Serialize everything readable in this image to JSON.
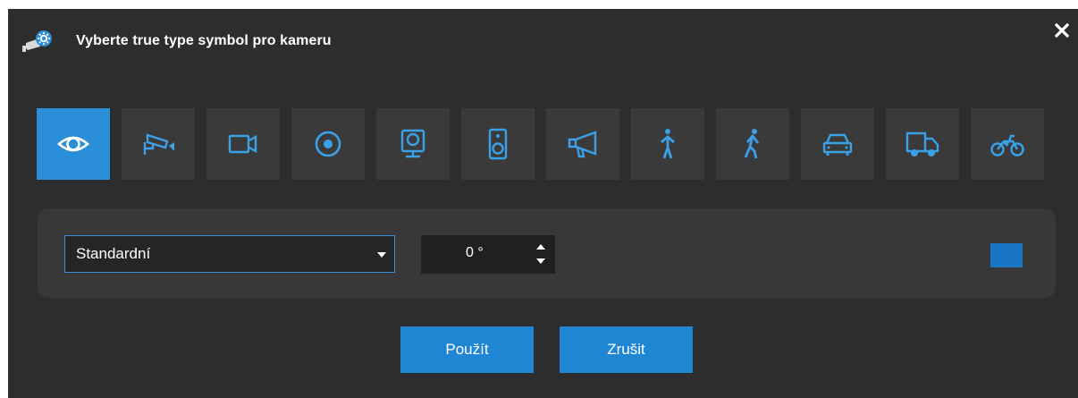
{
  "dialog": {
    "title": "Vyberte true type symbol pro kameru",
    "title_icon": "camera-settings-icon",
    "close_icon": "close-icon"
  },
  "symbols": [
    {
      "icon": "eye-icon",
      "selected": true
    },
    {
      "icon": "security-camera-icon",
      "selected": false
    },
    {
      "icon": "video-camera-icon",
      "selected": false
    },
    {
      "icon": "record-icon",
      "selected": false
    },
    {
      "icon": "webcam-icon",
      "selected": false
    },
    {
      "icon": "speaker-icon",
      "selected": false
    },
    {
      "icon": "megaphone-icon",
      "selected": false
    },
    {
      "icon": "person-standing-icon",
      "selected": false
    },
    {
      "icon": "person-walking-icon",
      "selected": false
    },
    {
      "icon": "car-icon",
      "selected": false
    },
    {
      "icon": "truck-icon",
      "selected": false
    },
    {
      "icon": "motorcycle-icon",
      "selected": false
    }
  ],
  "options": {
    "style_select": {
      "value": "Standardní"
    },
    "angle": {
      "value": "0 °"
    },
    "color": "#1a75c4"
  },
  "buttons": {
    "apply": "Použít",
    "cancel": "Zrušit"
  },
  "colors": {
    "background": "#2d2d2d",
    "tile": "#3a3a3a",
    "accent": "#2a8fd8",
    "panel": "#383838"
  }
}
